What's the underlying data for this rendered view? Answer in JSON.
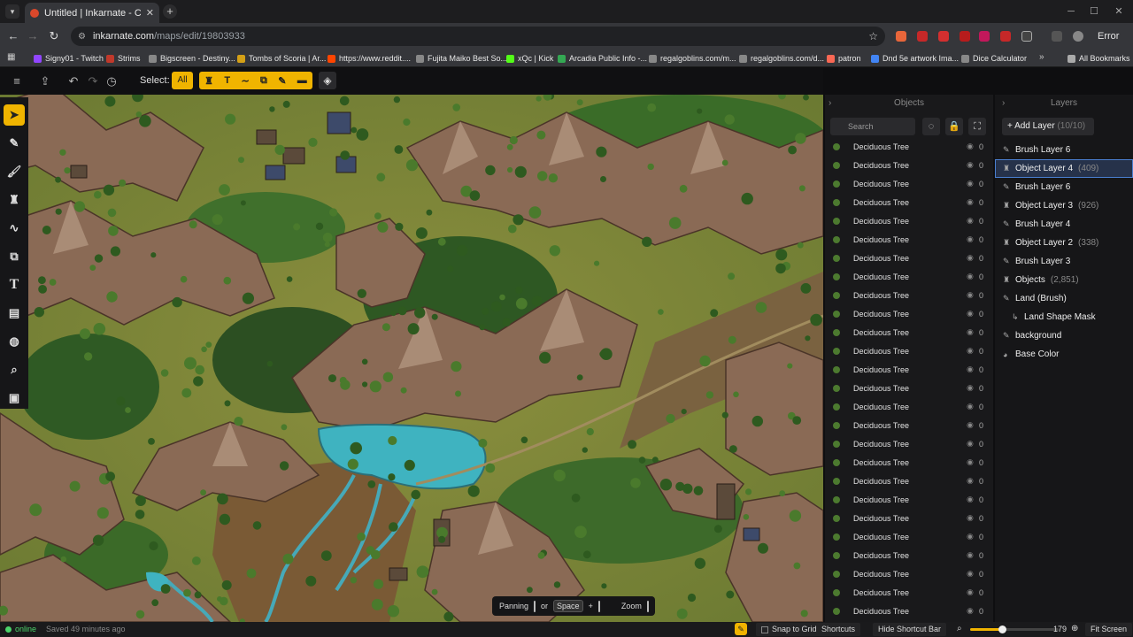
{
  "browser": {
    "tab_title": "Untitled | Inkarnate - Create Fa",
    "url_domain": "inkarnate.com",
    "url_path": "/maps/edit/19803933",
    "profile_label": "Error",
    "bookmarks": [
      {
        "label": "Signy01 - Twitch",
        "color": "#9146ff"
      },
      {
        "label": "Strims",
        "color": "#c0392b"
      },
      {
        "label": "Bigscreen - Destiny...",
        "color": "#888888"
      },
      {
        "label": "Tombs of Scoria | Ar...",
        "color": "#d4a017"
      },
      {
        "label": "https://www.reddit....",
        "color": "#ff4500"
      },
      {
        "label": "Fujita Maiko Best So...",
        "color": "#888888"
      },
      {
        "label": "xQc | Kick",
        "color": "#53fc18"
      },
      {
        "label": "Arcadia Public Info -...",
        "color": "#34a853"
      },
      {
        "label": "regalgoblins.com/m...",
        "color": "#888888"
      },
      {
        "label": "regalgoblins.com/d...",
        "color": "#888888"
      },
      {
        "label": "patron",
        "color": "#f96854"
      },
      {
        "label": "Dnd 5e artwork Ima...",
        "color": "#4285f4"
      },
      {
        "label": "Dice Calculator",
        "color": "#888888"
      }
    ],
    "all_bookmarks": "All Bookmarks"
  },
  "toolbar": {
    "select_label": "Select:",
    "all_label": "All"
  },
  "objects_panel": {
    "title": "Objects",
    "search_placeholder": "Search",
    "item_label": "Deciduous Tree",
    "item_count": "0",
    "visible_rows": 26
  },
  "layers_panel": {
    "title": "Layers",
    "add_layer": "Add Layer",
    "layer_count": "(10/10)",
    "layers": [
      {
        "name": "Brush Layer 6",
        "count": "",
        "icon": "brush-icon"
      },
      {
        "name": "Object Layer 4",
        "count": "(409)",
        "icon": "object-icon",
        "selected": true
      },
      {
        "name": "Brush Layer 6",
        "count": "",
        "icon": "brush-icon"
      },
      {
        "name": "Object Layer 3",
        "count": "(926)",
        "icon": "object-icon"
      },
      {
        "name": "Brush Layer 4",
        "count": "",
        "icon": "brush-icon"
      },
      {
        "name": "Object Layer 2",
        "count": "(338)",
        "icon": "object-icon"
      },
      {
        "name": "Brush Layer 3",
        "count": "",
        "icon": "brush-icon"
      },
      {
        "name": "Objects",
        "count": "(2,851)",
        "icon": "object-icon"
      },
      {
        "name": "Land (Brush)",
        "count": "",
        "icon": "brush-icon"
      },
      {
        "name": "Land Shape Mask",
        "count": "",
        "icon": "mask-icon",
        "indent": true
      },
      {
        "name": "background",
        "count": "",
        "icon": "brush-icon"
      },
      {
        "name": "Base Color",
        "count": "",
        "icon": "palette-icon"
      }
    ]
  },
  "shortcut_pill": {
    "panning": "Panning",
    "or": "or",
    "space": "Space",
    "plus": "+",
    "zoom": "Zoom"
  },
  "status": {
    "online": "online",
    "saved": "Saved 49 minutes ago",
    "snap_to_grid": "Snap to Grid",
    "shortcuts": "Shortcuts",
    "hide_shortcut_bar": "Hide Shortcut Bar",
    "zoom_value": "179",
    "zoom_fraction": 0.36,
    "fit_screen": "Fit Screen"
  },
  "colors": {
    "accent": "#f0b400",
    "selection": "#4a7fd0"
  }
}
